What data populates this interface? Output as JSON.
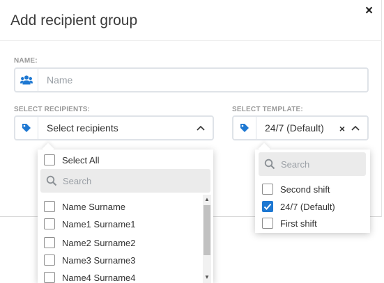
{
  "dialog": {
    "title": "Add recipient group",
    "close_icon": "close-icon",
    "close_glyph": "×"
  },
  "name_field": {
    "label": "NAME:",
    "placeholder": "Name",
    "icon": "users-icon"
  },
  "recipients_field": {
    "label": "SELECT RECIPIENTS:",
    "value": "Select recipients",
    "icon": "tag-icon",
    "expanded": true
  },
  "template_field": {
    "label": "SELECT TEMPLATE:",
    "value": "24/7 (Default)",
    "clear_glyph": "×",
    "icon": "tag-icon",
    "expanded": true
  },
  "recipients_dropdown": {
    "select_all": "Select All",
    "search_placeholder": "Search",
    "options": [
      {
        "label": "Name Surname",
        "checked": false
      },
      {
        "label": "Name1 Surname1",
        "checked": false
      },
      {
        "label": "Name2 Surname2",
        "checked": false
      },
      {
        "label": "Name3 Surname3",
        "checked": false
      },
      {
        "label": "Name4 Surname4",
        "checked": false
      }
    ]
  },
  "template_dropdown": {
    "search_placeholder": "Search",
    "options": [
      {
        "label": "Second shift",
        "checked": false
      },
      {
        "label": "24/7 (Default)",
        "checked": true
      },
      {
        "label": "First shift",
        "checked": false
      }
    ]
  },
  "colors": {
    "accent": "#1e78d2",
    "label_gray": "#999999",
    "border": "#dfe3e8"
  }
}
